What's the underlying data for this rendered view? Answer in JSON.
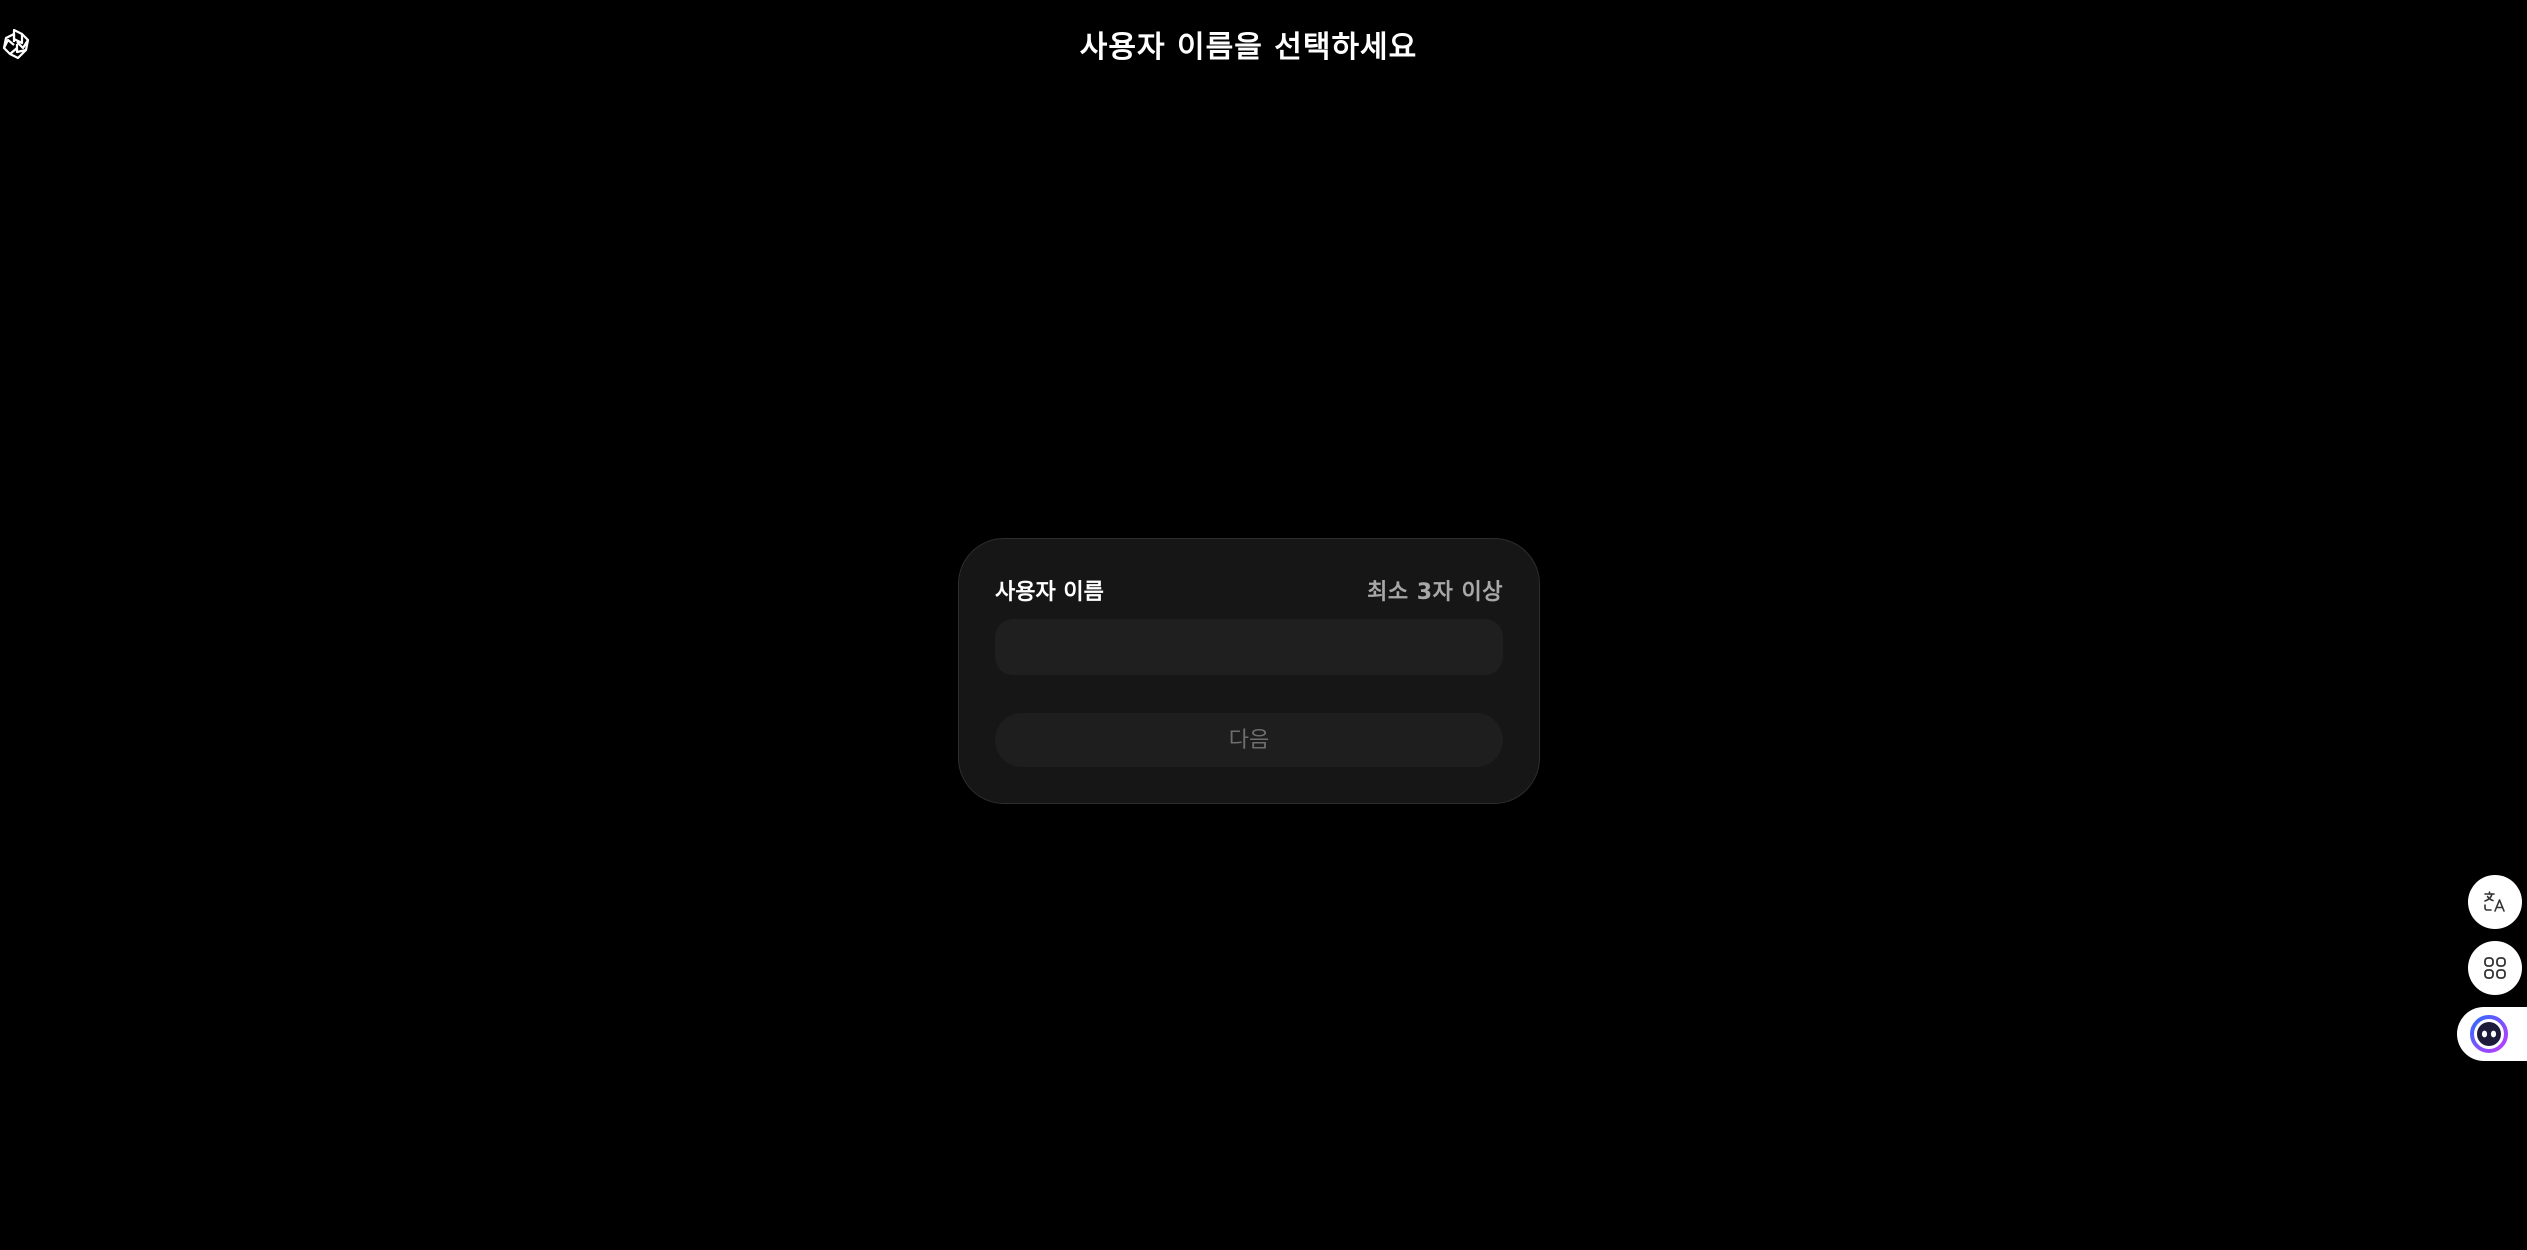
{
  "header": {
    "logo_icon": "openai-logo-icon",
    "title": "사용자 이름을 선택하세요"
  },
  "form": {
    "label": "사용자 이름",
    "hint": "최소 3자 이상",
    "input_value": "",
    "input_placeholder": "",
    "next_button_label": "다음"
  },
  "floating": {
    "translate_icon": "translate-icon",
    "apps_icon": "apps-grid-icon",
    "assistant_icon": "assistant-face-icon"
  },
  "colors": {
    "background": "#000000",
    "card_background": "#161616",
    "input_background": "#1f1f1f",
    "disabled_text": "#6e6e6e",
    "hint_text": "#a8a8a8",
    "assistant_gradient_start": "#2f6bff",
    "assistant_gradient_end": "#c13cff"
  }
}
